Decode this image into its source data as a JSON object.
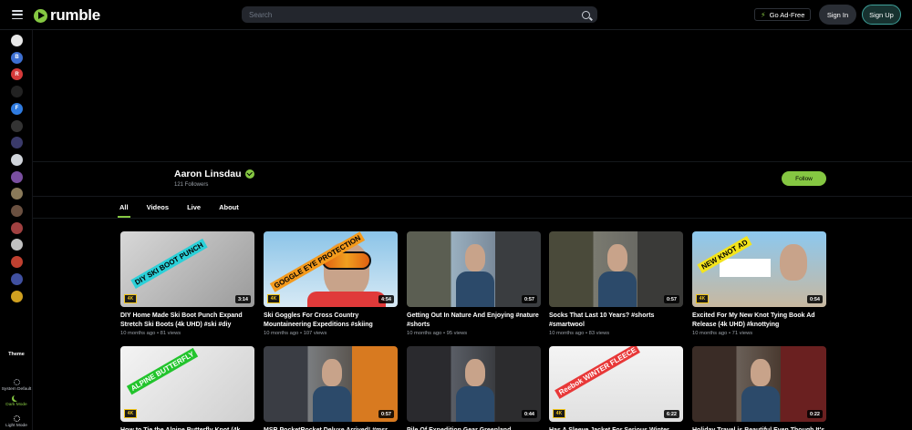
{
  "header": {
    "brand": "rumble",
    "search_placeholder": "Search",
    "ad_free_label": "Go Ad-Free",
    "sign_in": "Sign In",
    "sign_up": "Sign Up"
  },
  "sidebar": {
    "theme_title": "Theme",
    "theme_options": [
      "System Default",
      "Dark Mode",
      "Light Mode"
    ],
    "active_theme": "Dark Mode",
    "channel_icons": [
      {
        "letter": "",
        "color": "#e8e8e8"
      },
      {
        "letter": "B",
        "color": "#3d6fd1"
      },
      {
        "letter": "R",
        "color": "#d63a3a"
      },
      {
        "letter": "",
        "color": "#222"
      },
      {
        "letter": "F",
        "color": "#2f7be0"
      },
      {
        "letter": "",
        "color": "#333"
      },
      {
        "letter": "",
        "color": "#3a3a6a"
      },
      {
        "letter": "",
        "color": "#d0d4da"
      },
      {
        "letter": "",
        "color": "#7a4fa0"
      },
      {
        "letter": "",
        "color": "#8a7a5a"
      },
      {
        "letter": "",
        "color": "#6a5040"
      },
      {
        "letter": "",
        "color": "#a04040"
      },
      {
        "letter": "",
        "color": "#c0c0c0"
      },
      {
        "letter": "",
        "color": "#c04030"
      },
      {
        "letter": "",
        "color": "#4050a0"
      },
      {
        "letter": "",
        "color": "#d0a020"
      }
    ]
  },
  "channel": {
    "name": "Aaron Linsdau",
    "followers": "121 Followers",
    "follow_label": "Follow"
  },
  "tabs": [
    "All",
    "Videos",
    "Live",
    "About"
  ],
  "videos": [
    {
      "title": "DIY Home Made Ski Boot Punch Expand Stretch Ski Boots (4k UHD) #ski #diy",
      "meta": "10 months ago • 81 views",
      "duration": "3:14",
      "overlay": "DIY SKI BOOT PUNCH",
      "badge4k": true
    },
    {
      "title": "Ski Goggles For Cross Country Mountaineering Expeditions #skiing",
      "meta": "10 months ago • 107 views",
      "duration": "4:54",
      "overlay": "GOGGLE EYE PROTECTION",
      "badge4k": true
    },
    {
      "title": "Getting Out In Nature And Enjoying #nature #shorts",
      "meta": "10 months ago • 95 views",
      "duration": "0:57",
      "overlay": "",
      "badge4k": false
    },
    {
      "title": "Socks That Last 10 Years? #shorts #smartwool",
      "meta": "10 months ago • 83 views",
      "duration": "0:57",
      "overlay": "",
      "badge4k": false
    },
    {
      "title": "Excited For My New Knot Tying Book Ad Release (4k UHD) #knottying",
      "meta": "10 months ago • 71 views",
      "duration": "0:54",
      "overlay": "NEW KNOT AD",
      "badge4k": true
    },
    {
      "title": "How to Tie the Alpine Butterfly Knot (4k",
      "meta": "",
      "duration": "",
      "overlay": "ALPINE BUTTERFLY",
      "badge4k": true
    },
    {
      "title": "MSR PocketRocket Deluxe Arrived! #msr",
      "meta": "",
      "duration": "0:57",
      "overlay": "",
      "badge4k": false
    },
    {
      "title": "Pile Of Expedition Gear Greenland",
      "meta": "",
      "duration": "0:44",
      "overlay": "",
      "badge4k": false
    },
    {
      "title": "Has A Sleeve Jacket For Serious Winter",
      "meta": "",
      "duration": "6:22",
      "overlay": "Reebok WINTER FLEECE",
      "badge4k": true
    },
    {
      "title": "Holiday Travel is Beautiful Even Though It's",
      "meta": "",
      "duration": "0:22",
      "overlay": "",
      "badge4k": false
    }
  ]
}
